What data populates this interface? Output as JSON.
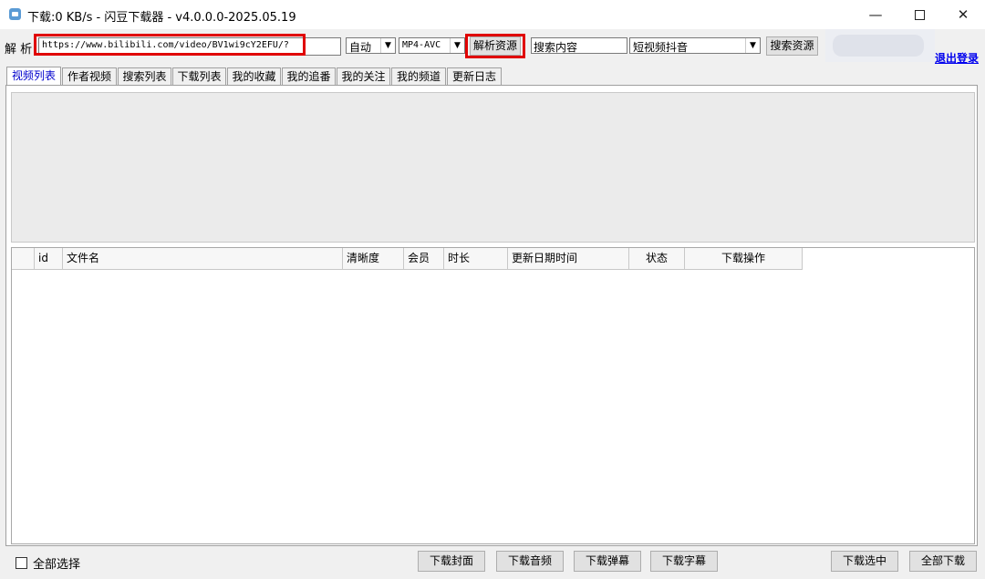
{
  "window": {
    "title": "下载:0 KB/s - 闪豆下载器 - v4.0.0.0-2025.05.19",
    "minimize_glyph": "—",
    "close_glyph": "✕"
  },
  "toolbar": {
    "parse_label": "解 析",
    "url_value": "https://www.bilibili.com/video/BV1wi9cY2EFU/?",
    "quality_value": "自动",
    "format_value": "MP4-AVC",
    "parse_button": "解析资源",
    "search_value": "搜索内容",
    "platform_value": "短视频抖音",
    "search_button": "搜索资源",
    "logout_link": "退出登录",
    "dropdown_glyph": "▼"
  },
  "tabs": [
    {
      "label": "视频列表",
      "active": true
    },
    {
      "label": "作者视频"
    },
    {
      "label": "搜索列表"
    },
    {
      "label": "下载列表"
    },
    {
      "label": "我的收藏"
    },
    {
      "label": "我的追番"
    },
    {
      "label": "我的关注"
    },
    {
      "label": "我的频道"
    },
    {
      "label": "更新日志"
    }
  ],
  "table": {
    "columns": [
      "",
      "id",
      "文件名",
      "清晰度",
      "会员",
      "时长",
      "更新日期时间",
      "状态",
      "下载操作"
    ],
    "rows": []
  },
  "bottom": {
    "select_all": "全部选择",
    "download_cover": "下载封面",
    "download_audio": "下载音频",
    "download_danmaku": "下载弹幕",
    "download_subtitle": "下载字幕",
    "download_selected": "下载选中",
    "download_all": "全部下载"
  },
  "colors": {
    "highlight_frame": "#e00000",
    "active_tab_text": "#0000cc",
    "link": "#0000ee"
  }
}
